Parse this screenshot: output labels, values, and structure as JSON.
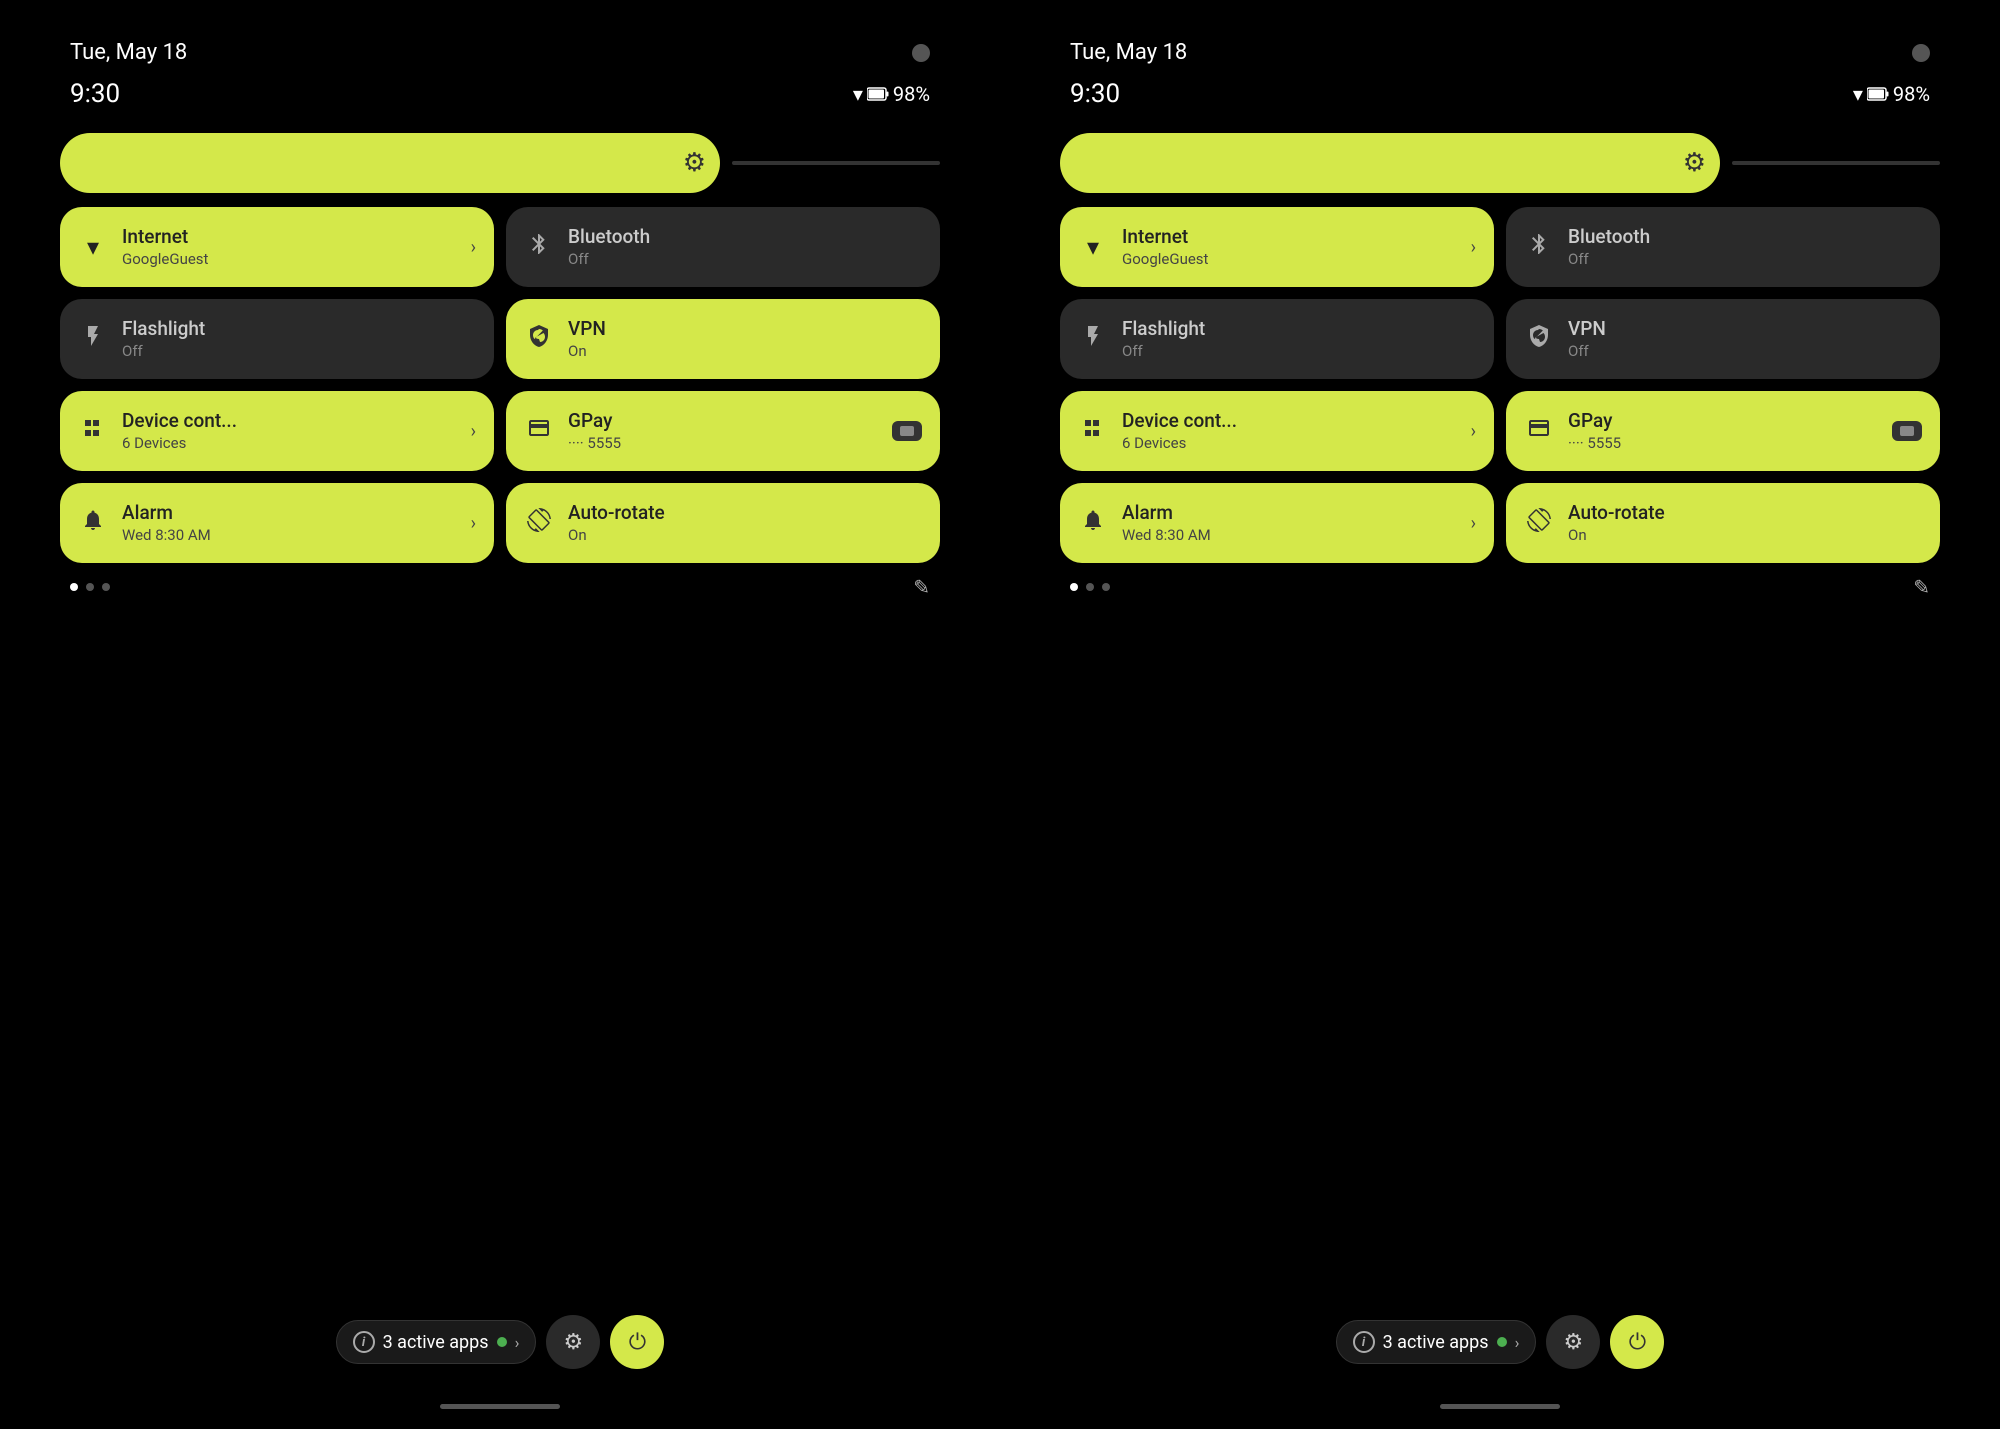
{
  "panel_left": {
    "date": "Tue, May 18",
    "time": "9:30",
    "battery": "98%",
    "brightness_slider_pct": 75,
    "tiles": [
      {
        "id": "internet",
        "title": "Internet",
        "subtitle": "GoogleGuest",
        "active": true,
        "icon": "wifi",
        "has_chevron": true
      },
      {
        "id": "bluetooth",
        "title": "Bluetooth",
        "subtitle": "Off",
        "active": false,
        "icon": "bluetooth",
        "has_chevron": false
      },
      {
        "id": "flashlight",
        "title": "Flashlight",
        "subtitle": "Off",
        "active": false,
        "icon": "flashlight",
        "has_chevron": false
      },
      {
        "id": "vpn",
        "title": "VPN",
        "subtitle": "On",
        "active": true,
        "icon": "vpn",
        "has_chevron": false
      },
      {
        "id": "device",
        "title": "Device cont...",
        "subtitle": "6 Devices",
        "active": true,
        "icon": "device",
        "has_chevron": true
      },
      {
        "id": "gpay",
        "title": "GPay",
        "subtitle": "···· 5555",
        "active": true,
        "icon": "gpay",
        "has_chevron": false
      },
      {
        "id": "alarm",
        "title": "Alarm",
        "subtitle": "Wed 8:30 AM",
        "active": true,
        "icon": "alarm",
        "has_chevron": true
      },
      {
        "id": "autorotate",
        "title": "Auto-rotate",
        "subtitle": "On",
        "active": true,
        "icon": "autorotate",
        "has_chevron": false
      }
    ],
    "active_apps_count": "3 active apps",
    "dots": [
      true,
      false,
      false
    ]
  },
  "panel_right": {
    "date": "Tue, May 18",
    "time": "9:30",
    "battery": "98%",
    "brightness_slider_pct": 75,
    "tiles": [
      {
        "id": "internet",
        "title": "Internet",
        "subtitle": "GoogleGuest",
        "active": true,
        "icon": "wifi",
        "has_chevron": true
      },
      {
        "id": "bluetooth",
        "title": "Bluetooth",
        "subtitle": "Off",
        "active": false,
        "icon": "bluetooth",
        "has_chevron": false
      },
      {
        "id": "flashlight",
        "title": "Flashlight",
        "subtitle": "Off",
        "active": false,
        "icon": "flashlight",
        "has_chevron": false
      },
      {
        "id": "vpn",
        "title": "VPN",
        "subtitle": "Off",
        "active": false,
        "icon": "vpn",
        "has_chevron": false
      },
      {
        "id": "device",
        "title": "Device cont...",
        "subtitle": "6 Devices",
        "active": true,
        "icon": "device",
        "has_chevron": true
      },
      {
        "id": "gpay",
        "title": "GPay",
        "subtitle": "···· 5555",
        "active": true,
        "icon": "gpay",
        "has_chevron": false
      },
      {
        "id": "alarm",
        "title": "Alarm",
        "subtitle": "Wed 8:30 AM",
        "active": true,
        "icon": "alarm",
        "has_chevron": true
      },
      {
        "id": "autorotate",
        "title": "Auto-rotate",
        "subtitle": "On",
        "active": true,
        "icon": "autorotate",
        "has_chevron": false
      }
    ],
    "active_apps_count": "3 active apps",
    "dots": [
      true,
      false,
      false
    ]
  },
  "icons": {
    "wifi": "▼",
    "bluetooth": "✱",
    "flashlight": "🔦",
    "vpn": "⊙",
    "device": "⌂",
    "gpay": "▬",
    "alarm": "⏰",
    "autorotate": "↻",
    "gear": "⚙",
    "edit": "✎",
    "info": "i",
    "settings": "⚙",
    "power": "⏻",
    "chevron": "›"
  },
  "colors": {
    "active_tile": "#d4e84a",
    "inactive_tile": "#2a2a2a",
    "background": "#000000",
    "accent": "#d4e84a"
  }
}
